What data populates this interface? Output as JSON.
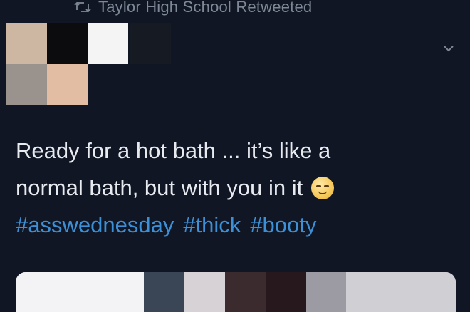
{
  "retweet": {
    "text": "Taylor High School Retweeted",
    "icon": "retweet-icon"
  },
  "tweet": {
    "line1": "Ready for a hot bath ... it’s like a",
    "line2": "normal bath, but with you in it",
    "emoji": "smirking-face-emoji",
    "hashtags": [
      "#asswednesday",
      "#thick",
      "#booty"
    ]
  },
  "menu": {
    "icon": "chevron-down-icon"
  },
  "colors": {
    "background": "#101624",
    "text": "#e7ebf0",
    "muted": "#7e8896",
    "hashtag": "#3d8fd6"
  }
}
